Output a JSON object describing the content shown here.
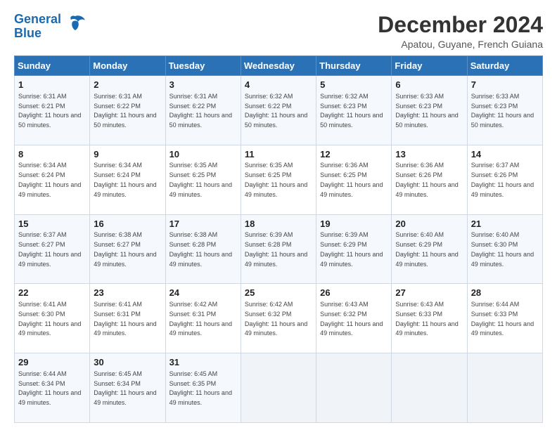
{
  "header": {
    "logo_line1": "General",
    "logo_line2": "Blue",
    "main_title": "December 2024",
    "subtitle": "Apatou, Guyane, French Guiana"
  },
  "days_of_week": [
    "Sunday",
    "Monday",
    "Tuesday",
    "Wednesday",
    "Thursday",
    "Friday",
    "Saturday"
  ],
  "weeks": [
    [
      {
        "day": "1",
        "sunrise": "6:31 AM",
        "sunset": "6:21 PM",
        "daylight": "11 hours and 50 minutes."
      },
      {
        "day": "2",
        "sunrise": "6:31 AM",
        "sunset": "6:22 PM",
        "daylight": "11 hours and 50 minutes."
      },
      {
        "day": "3",
        "sunrise": "6:31 AM",
        "sunset": "6:22 PM",
        "daylight": "11 hours and 50 minutes."
      },
      {
        "day": "4",
        "sunrise": "6:32 AM",
        "sunset": "6:22 PM",
        "daylight": "11 hours and 50 minutes."
      },
      {
        "day": "5",
        "sunrise": "6:32 AM",
        "sunset": "6:23 PM",
        "daylight": "11 hours and 50 minutes."
      },
      {
        "day": "6",
        "sunrise": "6:33 AM",
        "sunset": "6:23 PM",
        "daylight": "11 hours and 50 minutes."
      },
      {
        "day": "7",
        "sunrise": "6:33 AM",
        "sunset": "6:23 PM",
        "daylight": "11 hours and 50 minutes."
      }
    ],
    [
      {
        "day": "8",
        "sunrise": "6:34 AM",
        "sunset": "6:24 PM",
        "daylight": "11 hours and 49 minutes."
      },
      {
        "day": "9",
        "sunrise": "6:34 AM",
        "sunset": "6:24 PM",
        "daylight": "11 hours and 49 minutes."
      },
      {
        "day": "10",
        "sunrise": "6:35 AM",
        "sunset": "6:25 PM",
        "daylight": "11 hours and 49 minutes."
      },
      {
        "day": "11",
        "sunrise": "6:35 AM",
        "sunset": "6:25 PM",
        "daylight": "11 hours and 49 minutes."
      },
      {
        "day": "12",
        "sunrise": "6:36 AM",
        "sunset": "6:25 PM",
        "daylight": "11 hours and 49 minutes."
      },
      {
        "day": "13",
        "sunrise": "6:36 AM",
        "sunset": "6:26 PM",
        "daylight": "11 hours and 49 minutes."
      },
      {
        "day": "14",
        "sunrise": "6:37 AM",
        "sunset": "6:26 PM",
        "daylight": "11 hours and 49 minutes."
      }
    ],
    [
      {
        "day": "15",
        "sunrise": "6:37 AM",
        "sunset": "6:27 PM",
        "daylight": "11 hours and 49 minutes."
      },
      {
        "day": "16",
        "sunrise": "6:38 AM",
        "sunset": "6:27 PM",
        "daylight": "11 hours and 49 minutes."
      },
      {
        "day": "17",
        "sunrise": "6:38 AM",
        "sunset": "6:28 PM",
        "daylight": "11 hours and 49 minutes."
      },
      {
        "day": "18",
        "sunrise": "6:39 AM",
        "sunset": "6:28 PM",
        "daylight": "11 hours and 49 minutes."
      },
      {
        "day": "19",
        "sunrise": "6:39 AM",
        "sunset": "6:29 PM",
        "daylight": "11 hours and 49 minutes."
      },
      {
        "day": "20",
        "sunrise": "6:40 AM",
        "sunset": "6:29 PM",
        "daylight": "11 hours and 49 minutes."
      },
      {
        "day": "21",
        "sunrise": "6:40 AM",
        "sunset": "6:30 PM",
        "daylight": "11 hours and 49 minutes."
      }
    ],
    [
      {
        "day": "22",
        "sunrise": "6:41 AM",
        "sunset": "6:30 PM",
        "daylight": "11 hours and 49 minutes."
      },
      {
        "day": "23",
        "sunrise": "6:41 AM",
        "sunset": "6:31 PM",
        "daylight": "11 hours and 49 minutes."
      },
      {
        "day": "24",
        "sunrise": "6:42 AM",
        "sunset": "6:31 PM",
        "daylight": "11 hours and 49 minutes."
      },
      {
        "day": "25",
        "sunrise": "6:42 AM",
        "sunset": "6:32 PM",
        "daylight": "11 hours and 49 minutes."
      },
      {
        "day": "26",
        "sunrise": "6:43 AM",
        "sunset": "6:32 PM",
        "daylight": "11 hours and 49 minutes."
      },
      {
        "day": "27",
        "sunrise": "6:43 AM",
        "sunset": "6:33 PM",
        "daylight": "11 hours and 49 minutes."
      },
      {
        "day": "28",
        "sunrise": "6:44 AM",
        "sunset": "6:33 PM",
        "daylight": "11 hours and 49 minutes."
      }
    ],
    [
      {
        "day": "29",
        "sunrise": "6:44 AM",
        "sunset": "6:34 PM",
        "daylight": "11 hours and 49 minutes."
      },
      {
        "day": "30",
        "sunrise": "6:45 AM",
        "sunset": "6:34 PM",
        "daylight": "11 hours and 49 minutes."
      },
      {
        "day": "31",
        "sunrise": "6:45 AM",
        "sunset": "6:35 PM",
        "daylight": "11 hours and 49 minutes."
      },
      null,
      null,
      null,
      null
    ]
  ],
  "labels": {
    "sunrise": "Sunrise:",
    "sunset": "Sunset:",
    "daylight": "Daylight:"
  }
}
